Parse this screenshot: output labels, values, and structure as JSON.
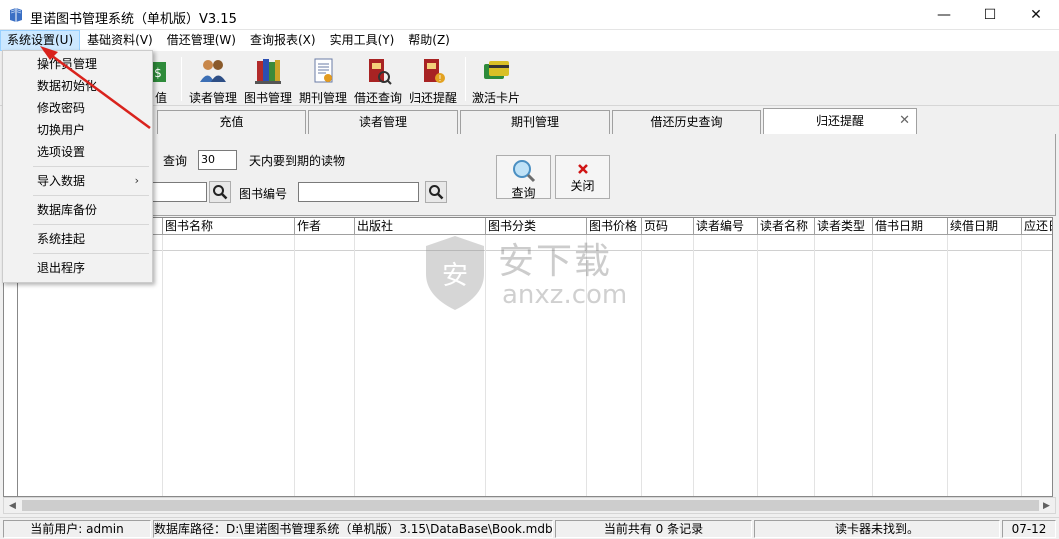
{
  "window": {
    "title": "里诺图书管理系统（单机版）V3.15",
    "minimize": "—",
    "maximize": "☐",
    "close": "✕"
  },
  "menubar": [
    {
      "label": "系统设置(U)",
      "active": true
    },
    {
      "label": "基础资料(V)"
    },
    {
      "label": "借还管理(W)"
    },
    {
      "label": "查询报表(X)"
    },
    {
      "label": "实用工具(Y)"
    },
    {
      "label": "帮助(Z)"
    }
  ],
  "dropdown": {
    "items": [
      {
        "label": "操作员管理"
      },
      {
        "label": "数据初始化"
      },
      {
        "label": "修改密码"
      },
      {
        "label": "切换用户"
      },
      {
        "label": "选项设置"
      },
      {
        "label": "导入数据",
        "submenu": true,
        "arrow": "›"
      },
      {
        "label": "数据库备份"
      },
      {
        "label": "系统挂起"
      },
      {
        "label": "退出程序"
      }
    ]
  },
  "toolbar": {
    "partial_label": "值",
    "buttons": [
      {
        "label": "读者管理",
        "icon": "readers-icon"
      },
      {
        "label": "图书管理",
        "icon": "books-icon"
      },
      {
        "label": "期刊管理",
        "icon": "periodical-icon"
      },
      {
        "label": "借还查询",
        "icon": "borrow-query-icon"
      },
      {
        "label": "归还提醒",
        "icon": "return-reminder-icon"
      },
      {
        "label": "激活卡片",
        "icon": "activate-card-icon"
      }
    ]
  },
  "tabs": [
    {
      "label": "充值"
    },
    {
      "label": "读者管理"
    },
    {
      "label": "期刊管理"
    },
    {
      "label": "借还历史查询"
    },
    {
      "label": "归还提醒",
      "active": true,
      "close": "✕"
    }
  ],
  "filter": {
    "query_label": "查询",
    "days_value": "30",
    "days_suffix": "天内要到期的读物",
    "book_no_label": "图书编号",
    "query_button": "查询",
    "close_button": "关闭"
  },
  "grid": {
    "columns": [
      "图书名称",
      "作者",
      "出版社",
      "图书分类",
      "图书价格",
      "页码",
      "读者编号",
      "读者名称",
      "读者类型",
      "借书日期",
      "续借日期",
      "应还日期"
    ],
    "rows": []
  },
  "statusbar": {
    "user": "当前用户: admin",
    "db_path": "数据库路径：D:\\里诺图书管理系统（单机版）3.15\\DataBase\\Book.mdb",
    "records": "当前共有 0 条记录",
    "card_reader": "读卡器未找到。",
    "date": "07-12"
  },
  "watermark": {
    "cn": "安下载",
    "en": "anxz.com"
  },
  "colors": {
    "menu_highlight": "#cce8ff",
    "annotation_arrow": "#d9231d"
  }
}
